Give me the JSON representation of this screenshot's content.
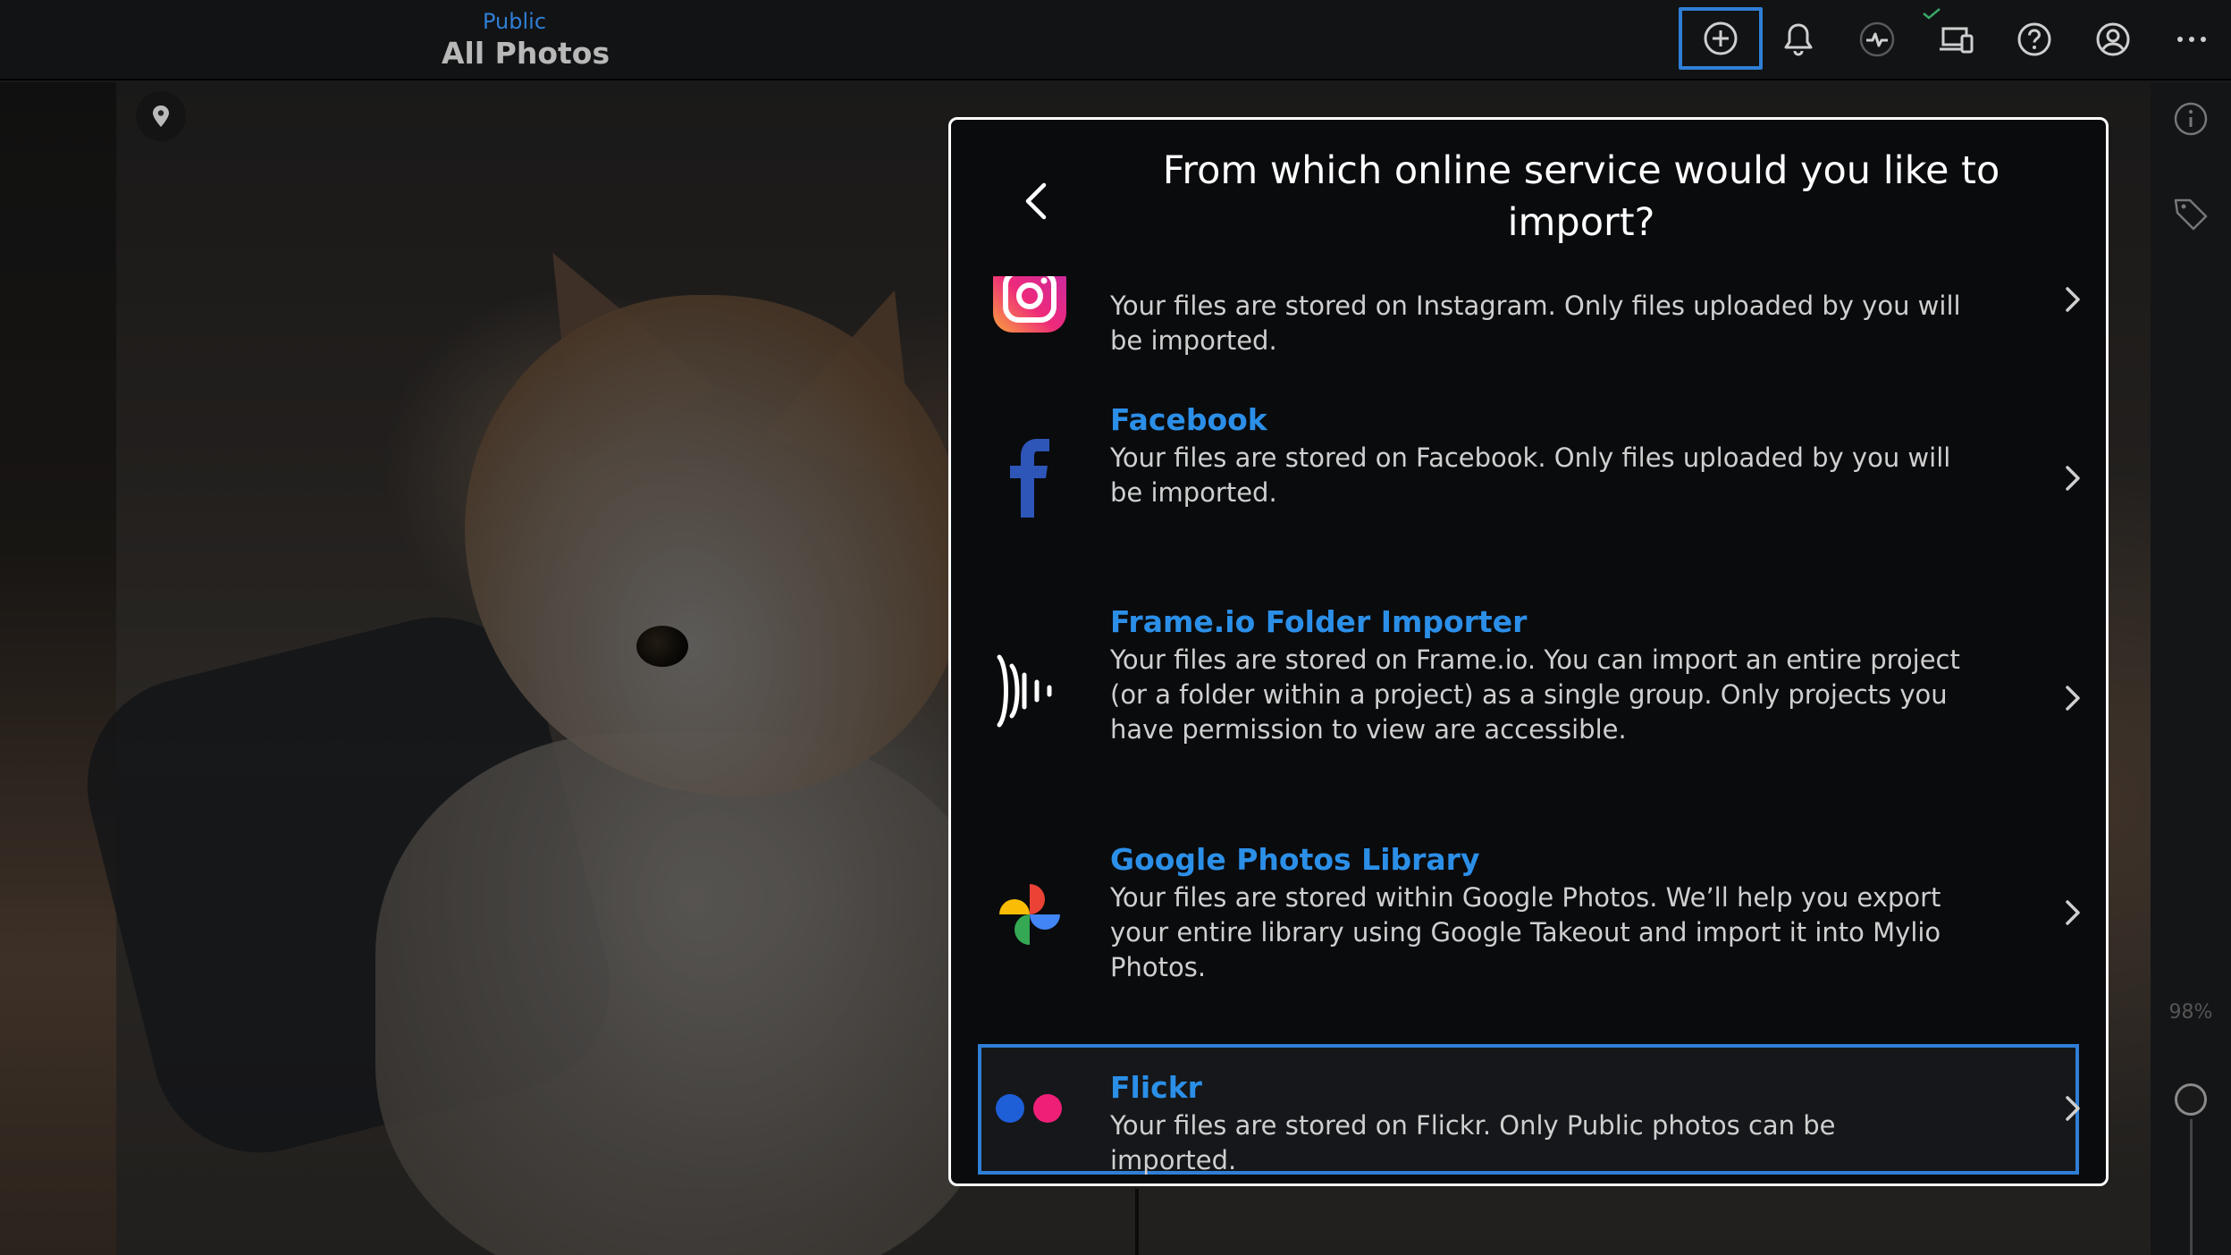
{
  "header": {
    "breadcrumb_sub": "Public",
    "title": "All Photos",
    "icons": [
      "add-circle-icon",
      "bell-icon",
      "activity-icon",
      "devices-icon",
      "help-icon",
      "account-icon",
      "more-icon"
    ],
    "accent_color": "#2f7fd6"
  },
  "right_rail": {
    "icons": [
      "info-icon",
      "tag-icon"
    ],
    "zoom_label": "98%"
  },
  "modal": {
    "title": "From which online service would you like to import?",
    "services": [
      {
        "name": "",
        "icon": "instagram-icon",
        "description": "Your files are stored on Instagram. Only files uploaded by you will be imported."
      },
      {
        "name": "Facebook",
        "icon": "facebook-icon",
        "description": "Your files are stored on Facebook. Only files uploaded by you will be imported."
      },
      {
        "name": "Frame.io Folder Importer",
        "icon": "frameio-icon",
        "description": "Your files are stored on Frame.io. You can import an entire project (or a folder within a project) as a single group. Only projects you have permission to view are accessible."
      },
      {
        "name": "Google Photos Library",
        "icon": "google-photos-icon",
        "description": "Your files are stored within Google Photos. We’ll help you export your entire library using Google Takeout and import it into Mylio Photos."
      },
      {
        "name": "Flickr",
        "icon": "flickr-icon",
        "description": "Your files are stored on Flickr. Only Public photos can be imported."
      }
    ],
    "link_color": "#2b8fe8"
  }
}
